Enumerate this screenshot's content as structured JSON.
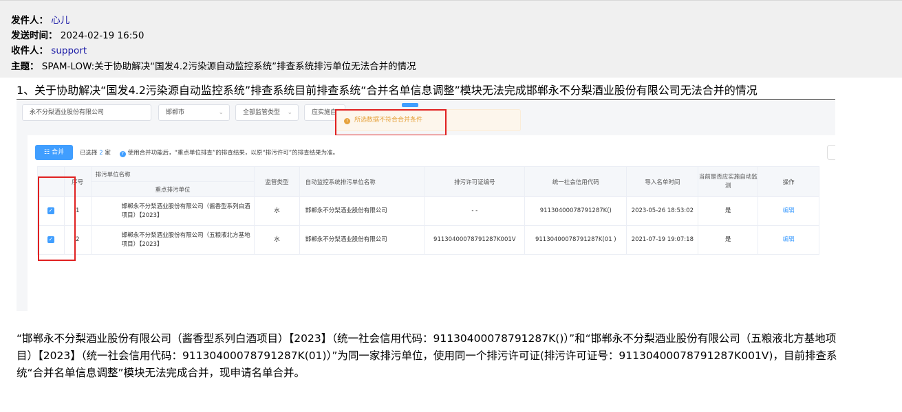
{
  "email": {
    "sender_label": "发件人：",
    "sender": "心儿",
    "sent_label": "发送时间：",
    "sent": "2024-02-19 16:50",
    "recipient_label": "收件人：",
    "recipient": "support",
    "subject_label": "主题：",
    "subject": "SPAM-LOW:关于协助解决“国发4.2污染源自动监控系统”排查系统排污单位无法合并的情况"
  },
  "body_title": "1、关于协助解决“国发4.2污染源自动监控系统”排查系统目前排查系统“合并名单信息调整”模块无法完成邯郸永不分梨酒业股份有限公司无法合并的情况",
  "screenshot": {
    "filters": {
      "company": "永不分梨酒业股份有限公司",
      "city": "邯郸市",
      "type": "全部监管类型",
      "status": "应实施自"
    },
    "toast": "所选数据不符合合并条件",
    "merge_button": "合并",
    "selected_prefix": "已选择",
    "selected_count": "2",
    "selected_suffix": "家",
    "hint": "使用合并功能后，“重点单位排查”的排查结果，以原“排污许可”的排查结果为准。",
    "columns": {
      "index": "序号",
      "unit_name": "排污单位名称",
      "key_unit": "重点排污单位",
      "supervision": "监管类型",
      "monitor_name": "自动监控系统排污单位名称",
      "permit_no": "排污许可证编号",
      "credit_code": "统一社会信用代码",
      "import_time": "导入名单时间",
      "should_monitor": "当前是否应实施自动监测",
      "action": "操作"
    },
    "rows": [
      {
        "index": "1",
        "key_unit": "邯郸永不分梨酒业股份有限公司（酱香型系列白酒项目）【2023】",
        "supervision": "水",
        "monitor_name": "邯郸永不分梨酒业股份有限公司",
        "permit_no": "- -",
        "credit_code": "91130400078791287K()",
        "import_time": "2023-05-26 18:53:02",
        "should_monitor": "是",
        "action": "编辑"
      },
      {
        "index": "2",
        "key_unit": "邯郸永不分梨酒业股份有限公司（五粮液北方基地项目）【2023】",
        "supervision": "水",
        "monitor_name": "邯郸永不分梨酒业股份有限公司",
        "permit_no": "91130400078791287K001V",
        "credit_code": "91130400078791287K(01 )",
        "import_time": "2021-07-19 19:07:18",
        "should_monitor": "是",
        "action": "编辑"
      }
    ]
  },
  "body_paragraph": "“邯郸永不分梨酒业股份有限公司（酱香型系列白酒项目）【2023】（统一社会信用代码：91130400078791287K()）”和“邯郸永不分梨酒业股份有限公司（五粮液北方基地项目）【2023】（统一社会信用代码：91130400078791287K(01)）”为同一家排污单位，使用同一个排污许可证(排污许可证号：91130400078791287K001V)，目前排查系统“合并名单信息调整”模块无法完成合并，现申请名单合并。",
  "colors": {
    "accent": "#409eff",
    "warning": "#e6a23c",
    "highlight_box": "#e02020",
    "link": "#1a1aa6"
  }
}
